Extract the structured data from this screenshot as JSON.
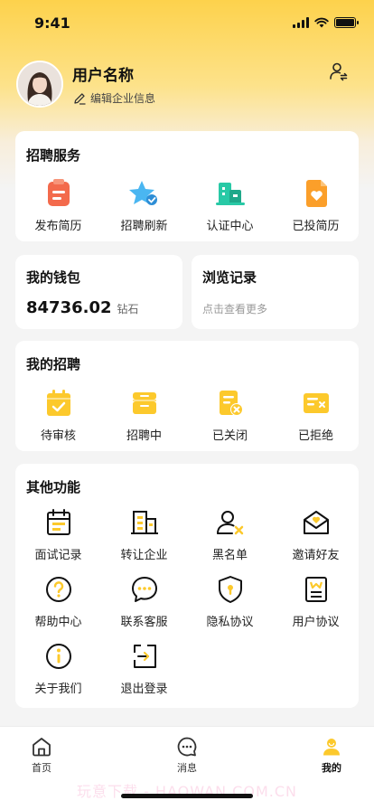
{
  "status": {
    "time": "9:41"
  },
  "profile": {
    "name": "用户名称",
    "edit_label": "编辑企业信息"
  },
  "recruit_service": {
    "title": "招聘服务",
    "items": [
      {
        "label": "发布简历",
        "icon": "resume-publish-icon"
      },
      {
        "label": "招聘刷新",
        "icon": "refresh-star-icon"
      },
      {
        "label": "认证中心",
        "icon": "building-cert-icon"
      },
      {
        "label": "已投简历",
        "icon": "submitted-resume-icon"
      }
    ]
  },
  "wallet": {
    "title": "我的钱包",
    "amount": "84736.02",
    "unit": "钻石"
  },
  "history": {
    "title": "浏览记录",
    "hint": "点击查看更多"
  },
  "my_recruit": {
    "title": "我的招聘",
    "items": [
      {
        "label": "待审核",
        "icon": "pending-review-icon"
      },
      {
        "label": "招聘中",
        "icon": "recruiting-icon"
      },
      {
        "label": "已关闭",
        "icon": "closed-icon"
      },
      {
        "label": "已拒绝",
        "icon": "rejected-icon"
      }
    ]
  },
  "other": {
    "title": "其他功能",
    "items": [
      {
        "label": "面试记录",
        "icon": "calendar-icon"
      },
      {
        "label": "转让企业",
        "icon": "building-icon"
      },
      {
        "label": "黑名单",
        "icon": "blacklist-user-icon"
      },
      {
        "label": "邀请好友",
        "icon": "invite-mail-icon"
      },
      {
        "label": "帮助中心",
        "icon": "help-icon"
      },
      {
        "label": "联系客服",
        "icon": "chat-service-icon"
      },
      {
        "label": "隐私协议",
        "icon": "privacy-shield-icon"
      },
      {
        "label": "用户协议",
        "icon": "user-agreement-icon"
      },
      {
        "label": "关于我们",
        "icon": "info-icon"
      },
      {
        "label": "退出登录",
        "icon": "logout-icon"
      }
    ]
  },
  "tabbar": {
    "items": [
      {
        "label": "首页",
        "icon": "home-icon"
      },
      {
        "label": "消息",
        "icon": "message-icon"
      },
      {
        "label": "我的",
        "icon": "profile-icon"
      }
    ],
    "active": "我的"
  },
  "watermark": "玩意下载 - HAOWAN.COM.CN",
  "colors": {
    "accent": "#fcc92c",
    "accent_bg": "#fde28a",
    "orange": "#f36a4c",
    "teal": "#28c9a6",
    "blue": "#4ab6f1"
  }
}
